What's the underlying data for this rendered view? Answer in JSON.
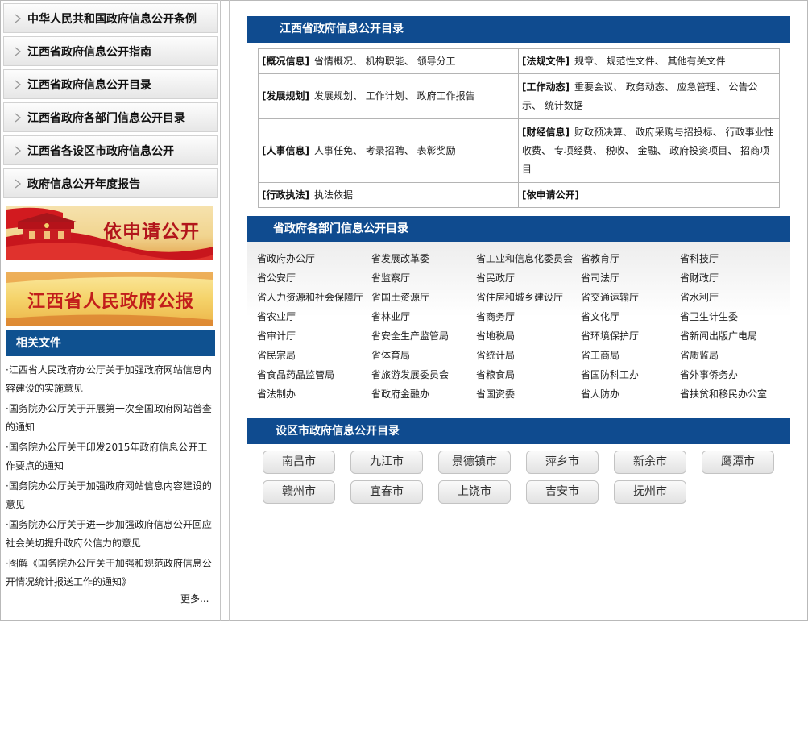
{
  "sidebar": {
    "nav": [
      "中华人民共和国政府信息公开条例",
      "江西省政府信息公开指南",
      "江西省政府信息公开目录",
      "江西省政府各部门信息公开目录",
      "江西省各设区市政府信息公开",
      "政府信息公开年度报告"
    ],
    "banners": [
      "依申请公开",
      "江西省人民政府公报"
    ],
    "related": {
      "title": "相关文件",
      "items": [
        "·江西省人民政府办公厅关于加强政府网站信息内容建设的实施意见",
        "·国务院办公厅关于开展第一次全国政府网站普查的通知",
        "·国务院办公厅关于印发2015年政府信息公开工作要点的通知",
        "·国务院办公厅关于加强政府网站信息内容建设的意见",
        "·国务院办公厅关于进一步加强政府信息公开回应社会关切提升政府公信力的意见",
        "·图解《国务院办公厅关于加强和规范政府信息公开情况统计报送工作的通知》"
      ],
      "more": "更多..."
    }
  },
  "catalog": {
    "title": "江西省政府信息公开目录",
    "rows": [
      [
        {
          "label": "[概况信息]",
          "text": "省情概况、 机构职能、 领导分工"
        },
        {
          "label": "[法规文件]",
          "text": "规章、 规范性文件、 其他有关文件"
        }
      ],
      [
        {
          "label": "[发展规划]",
          "text": "发展规划、 工作计划、 政府工作报告"
        },
        {
          "label": "[工作动态]",
          "text": "重要会议、 政务动态、 应急管理、 公告公示、 统计数据"
        }
      ],
      [
        {
          "label": "[人事信息]",
          "text": "人事任免、 考录招聘、 表彰奖励"
        },
        {
          "label": "[财经信息]",
          "text": "财政预决算、 政府采购与招投标、 行政事业性收费、 专项经费、 税收、 金融、 政府投资项目、 招商项目"
        }
      ],
      [
        {
          "label": "[行政执法]",
          "text": "执法依据"
        },
        {
          "label": "[依申请公开]",
          "text": ""
        }
      ]
    ]
  },
  "departments": {
    "title": "省政府各部门信息公开目录",
    "rows": [
      [
        "省政府办公厅",
        "省发展改革委",
        "省工业和信息化委员会",
        "省教育厅",
        "省科技厅"
      ],
      [
        "省公安厅",
        "省监察厅",
        "省民政厅",
        "省司法厅",
        "省财政厅"
      ],
      [
        "省人力资源和社会保障厅",
        "省国土资源厅",
        "省住房和城乡建设厅",
        "省交通运输厅",
        "省水利厅"
      ],
      [
        "省农业厅",
        "省林业厅",
        "省商务厅",
        "省文化厅",
        "省卫生计生委"
      ],
      [
        "省审计厅",
        "省安全生产监管局",
        "省地税局",
        "省环境保护厅",
        "省新闻出版广电局"
      ],
      [
        "省民宗局",
        "省体育局",
        "省统计局",
        "省工商局",
        "省质监局"
      ],
      [
        "省食品药品监管局",
        "省旅游发展委员会",
        "省粮食局",
        "省国防科工办",
        "省外事侨务办"
      ],
      [
        "省法制办",
        "省政府金融办",
        "省国资委",
        "省人防办",
        "省扶贫和移民办公室"
      ]
    ]
  },
  "cities": {
    "title": "设区市政府信息公开目录",
    "items": [
      "南昌市",
      "九江市",
      "景德镇市",
      "萍乡市",
      "新余市",
      "鹰潭市",
      "赣州市",
      "宜春市",
      "上饶市",
      "吉安市",
      "抚州市"
    ]
  }
}
